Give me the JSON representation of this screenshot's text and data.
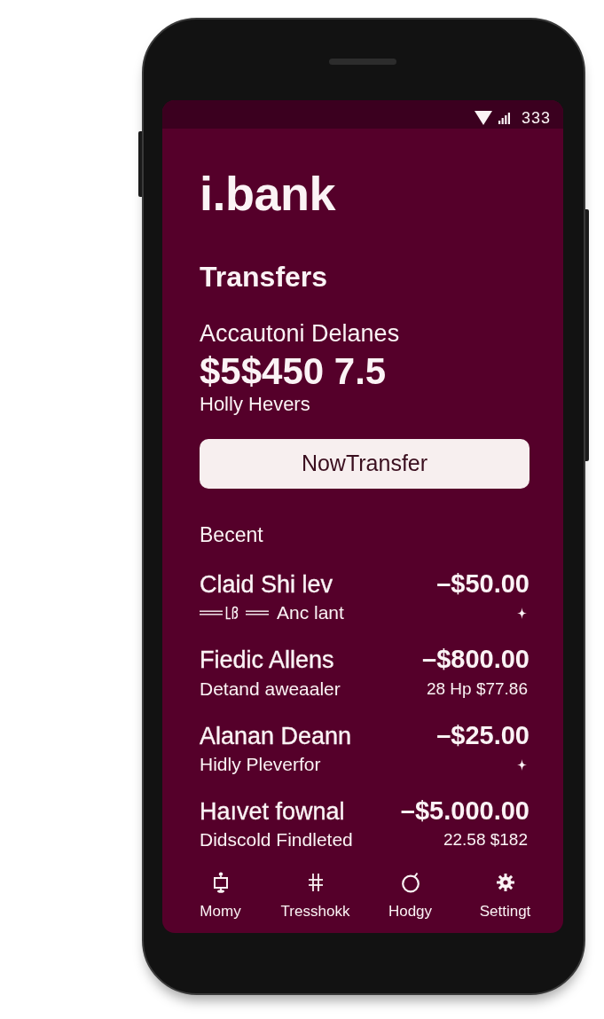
{
  "status_bar": {
    "time": "333"
  },
  "app": {
    "logo": "i.bank"
  },
  "page": {
    "title": "Transfers"
  },
  "account": {
    "label": "Accautoni Delanes",
    "balance": "$5$450 7.5",
    "holder": "Holly Hevers"
  },
  "primary_button": {
    "label": "NowTransfer"
  },
  "recent": {
    "heading": "Becent",
    "transactions": [
      {
        "name": "Claid Shi lev",
        "amount": "–$50.00",
        "detail": "Anc lant",
        "symbols": true,
        "kind": "sparkle"
      },
      {
        "name": "Fiedic Allens",
        "amount": "–$800.00",
        "detail": "Detand aweaaler",
        "symbols": false,
        "kind": "note",
        "note": "28 Hp $77.86"
      },
      {
        "name": "Alanan Deann",
        "amount": "–$25.00",
        "detail": "Hidly Pleverfor",
        "symbols": false,
        "kind": "sparkle"
      },
      {
        "name": "Haıvet fownal",
        "amount": "–$5.000.00",
        "detail": "Didscold Findleted",
        "symbols": false,
        "kind": "note",
        "note": "22.58 $182"
      }
    ]
  },
  "bottom_nav": [
    {
      "label": "Momy"
    },
    {
      "label": "Tresshokk"
    },
    {
      "label": "Hodgy"
    },
    {
      "label": "Settingt"
    }
  ]
}
